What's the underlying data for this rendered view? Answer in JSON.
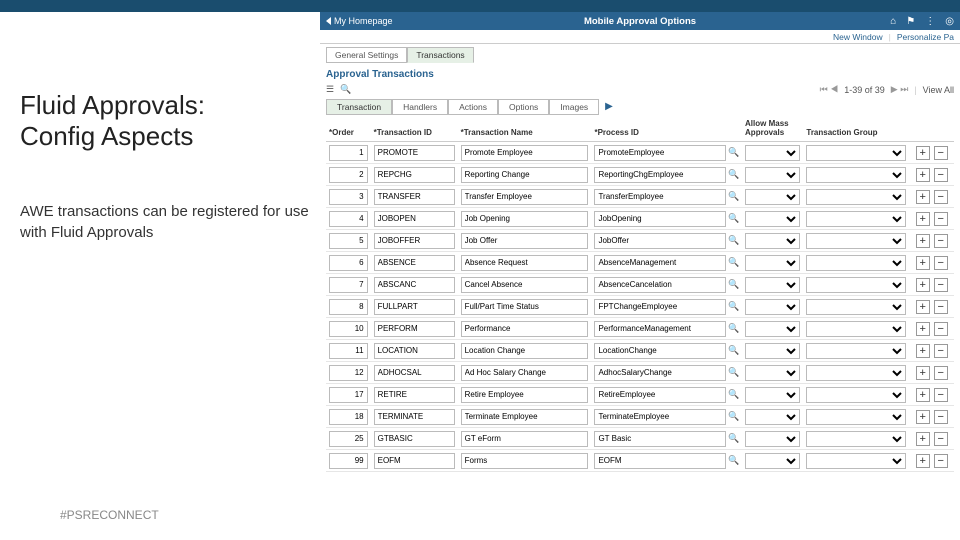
{
  "slide": {
    "title1": "Fluid Approvals:",
    "title2": "Config Aspects",
    "body": "AWE transactions can be registered for use with Fluid Approvals",
    "hashtag": "#PSRECONNECT"
  },
  "header": {
    "homepage_label": "My Homepage",
    "title": "Mobile Approval Options",
    "new_window": "New Window",
    "personalize": "Personalize Pa"
  },
  "breadcrumb_tabs": {
    "general": "General Settings",
    "transactions": "Transactions"
  },
  "section_title": "Approval Transactions",
  "pager": {
    "range": "1-39 of 39",
    "view_all": "View All"
  },
  "sub_tabs": {
    "transaction": "Transaction",
    "handlers": "Handlers",
    "actions": "Actions",
    "options": "Options",
    "images": "Images"
  },
  "columns": {
    "order": "*Order",
    "tid": "*Transaction ID",
    "tname": "*Transaction Name",
    "pid": "*Process ID",
    "allow": "Allow Mass Approvals",
    "tgrp": "Transaction Group"
  },
  "rows": [
    {
      "order": "1",
      "tid": "PROMOTE",
      "tname": "Promote Employee",
      "pid": "PromoteEmployee"
    },
    {
      "order": "2",
      "tid": "REPCHG",
      "tname": "Reporting Change",
      "pid": "ReportingChgEmployee"
    },
    {
      "order": "3",
      "tid": "TRANSFER",
      "tname": "Transfer Employee",
      "pid": "TransferEmployee"
    },
    {
      "order": "4",
      "tid": "JOBOPEN",
      "tname": "Job Opening",
      "pid": "JobOpening"
    },
    {
      "order": "5",
      "tid": "JOBOFFER",
      "tname": "Job Offer",
      "pid": "JobOffer"
    },
    {
      "order": "6",
      "tid": "ABSENCE",
      "tname": "Absence Request",
      "pid": "AbsenceManagement"
    },
    {
      "order": "7",
      "tid": "ABSCANC",
      "tname": "Cancel Absence",
      "pid": "AbsenceCancelation"
    },
    {
      "order": "8",
      "tid": "FULLPART",
      "tname": "Full/Part Time Status",
      "pid": "FPTChangeEmployee"
    },
    {
      "order": "10",
      "tid": "PERFORM",
      "tname": "Performance",
      "pid": "PerformanceManagement"
    },
    {
      "order": "11",
      "tid": "LOCATION",
      "tname": "Location Change",
      "pid": "LocationChange"
    },
    {
      "order": "12",
      "tid": "ADHOCSAL",
      "tname": "Ad Hoc Salary Change",
      "pid": "AdhocSalaryChange"
    },
    {
      "order": "17",
      "tid": "RETIRE",
      "tname": "Retire Employee",
      "pid": "RetireEmployee"
    },
    {
      "order": "18",
      "tid": "TERMINATE",
      "tname": "Terminate Employee",
      "pid": "TerminateEmployee"
    },
    {
      "order": "25",
      "tid": "GTBASIC",
      "tname": "GT eForm",
      "pid": "GT Basic"
    },
    {
      "order": "99",
      "tid": "EOFM",
      "tname": "Forms",
      "pid": "EOFM"
    }
  ]
}
